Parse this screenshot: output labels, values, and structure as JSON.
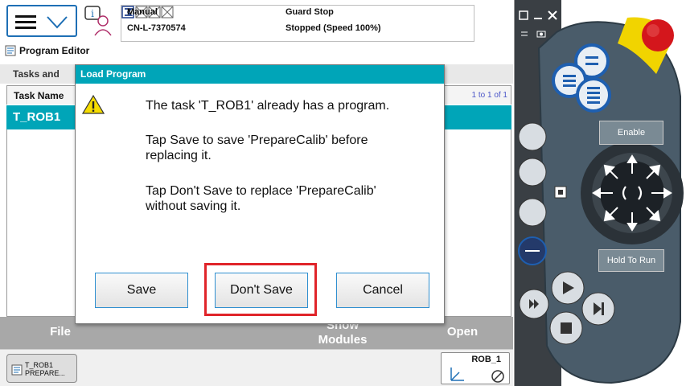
{
  "status": {
    "mode": "Manual",
    "controller": "CN-L-7370574",
    "guard": "Guard Stop",
    "state": "Stopped (Speed 100%)"
  },
  "app": {
    "title": "Program Editor"
  },
  "tasks": {
    "heading": "Tasks and",
    "col_task_name": "Task Name",
    "count": "1 to 1 of 1",
    "rows": [
      "T_ROB1"
    ]
  },
  "bottom": {
    "file": "File",
    "show": "Show",
    "modules": "Modules",
    "open": "Open"
  },
  "taskbar": {
    "task_line1": "T_ROB1",
    "task_line2": "PREPARE...",
    "rob": "ROB_1"
  },
  "dialog": {
    "title": "Load Program",
    "msg1": "The task 'T_ROB1' already has a program.",
    "msg2a": "Tap Save to save 'PrepareCalib' before",
    "msg2b": "replacing it.",
    "msg3a": "Tap Don't Save to replace 'PrepareCalib'",
    "msg3b": "without saving it.",
    "save": "Save",
    "dont_save": "Don't Save",
    "cancel": "Cancel"
  },
  "pendant": {
    "enable": "Enable",
    "hold_to_run": "Hold To Run"
  },
  "colors": {
    "accent": "#00a5b8",
    "highlight": "#e0242a",
    "pendant_body": "#4a5c6a",
    "emergency_stop": "#d4161c",
    "stop_collar": "#f1d400"
  }
}
